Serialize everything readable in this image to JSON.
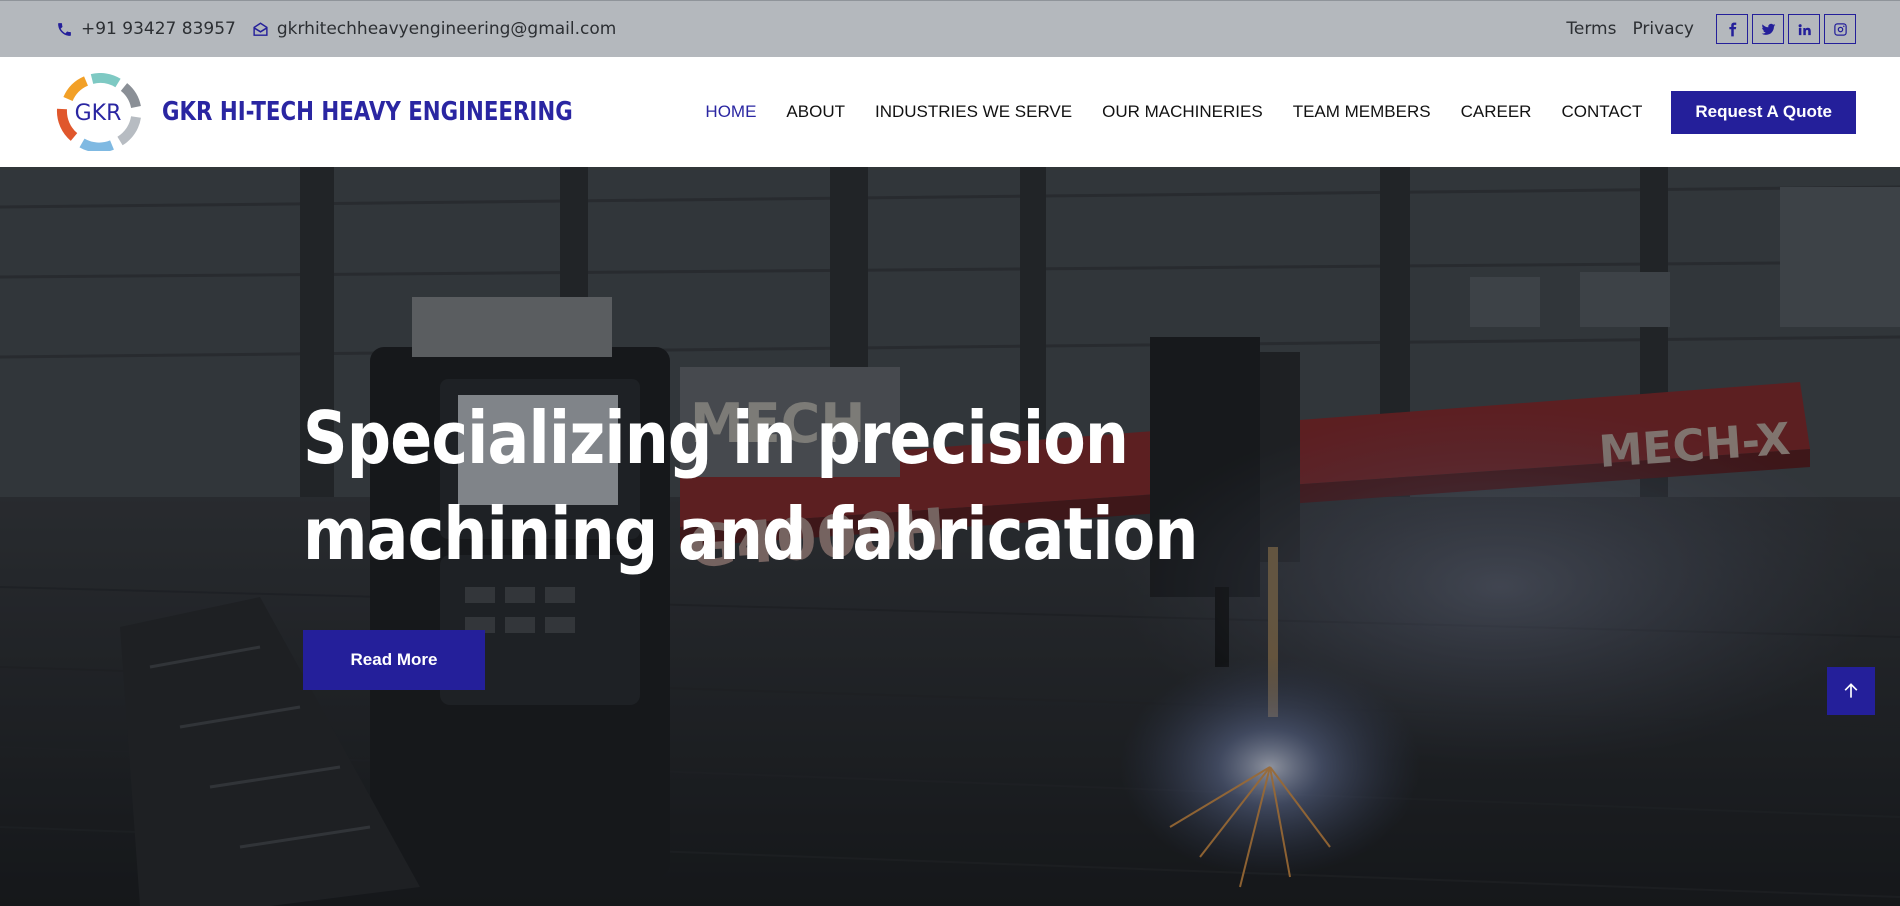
{
  "topbar": {
    "phone": "+91 93427 83957",
    "email": "gkrhitechheavyengineering@gmail.com",
    "links": [
      "Terms",
      "Privacy"
    ],
    "socials": [
      "facebook-icon",
      "twitter-icon",
      "linkedin-icon",
      "instagram-icon"
    ]
  },
  "brand": {
    "logo_text": "GKR",
    "name": "GKR HI-TECH HEAVY ENGINEERING"
  },
  "nav": {
    "items": [
      "HOME",
      "ABOUT",
      "INDUSTRIES WE SERVE",
      "OUR MACHINERIES",
      "TEAM MEMBERS",
      "CAREER",
      "CONTACT"
    ],
    "active": "HOME",
    "cta": "Request A Quote"
  },
  "hero": {
    "title_line1": "Specializing in precision",
    "title_line2": "machining and fabrication",
    "button": "Read More",
    "machine_text": [
      "MECH-X",
      "G4000H",
      "MECH"
    ]
  },
  "colors": {
    "brand": "#241f9a",
    "topbar_bg": "#b4b8bd",
    "nav_bg": "#ffffff"
  }
}
